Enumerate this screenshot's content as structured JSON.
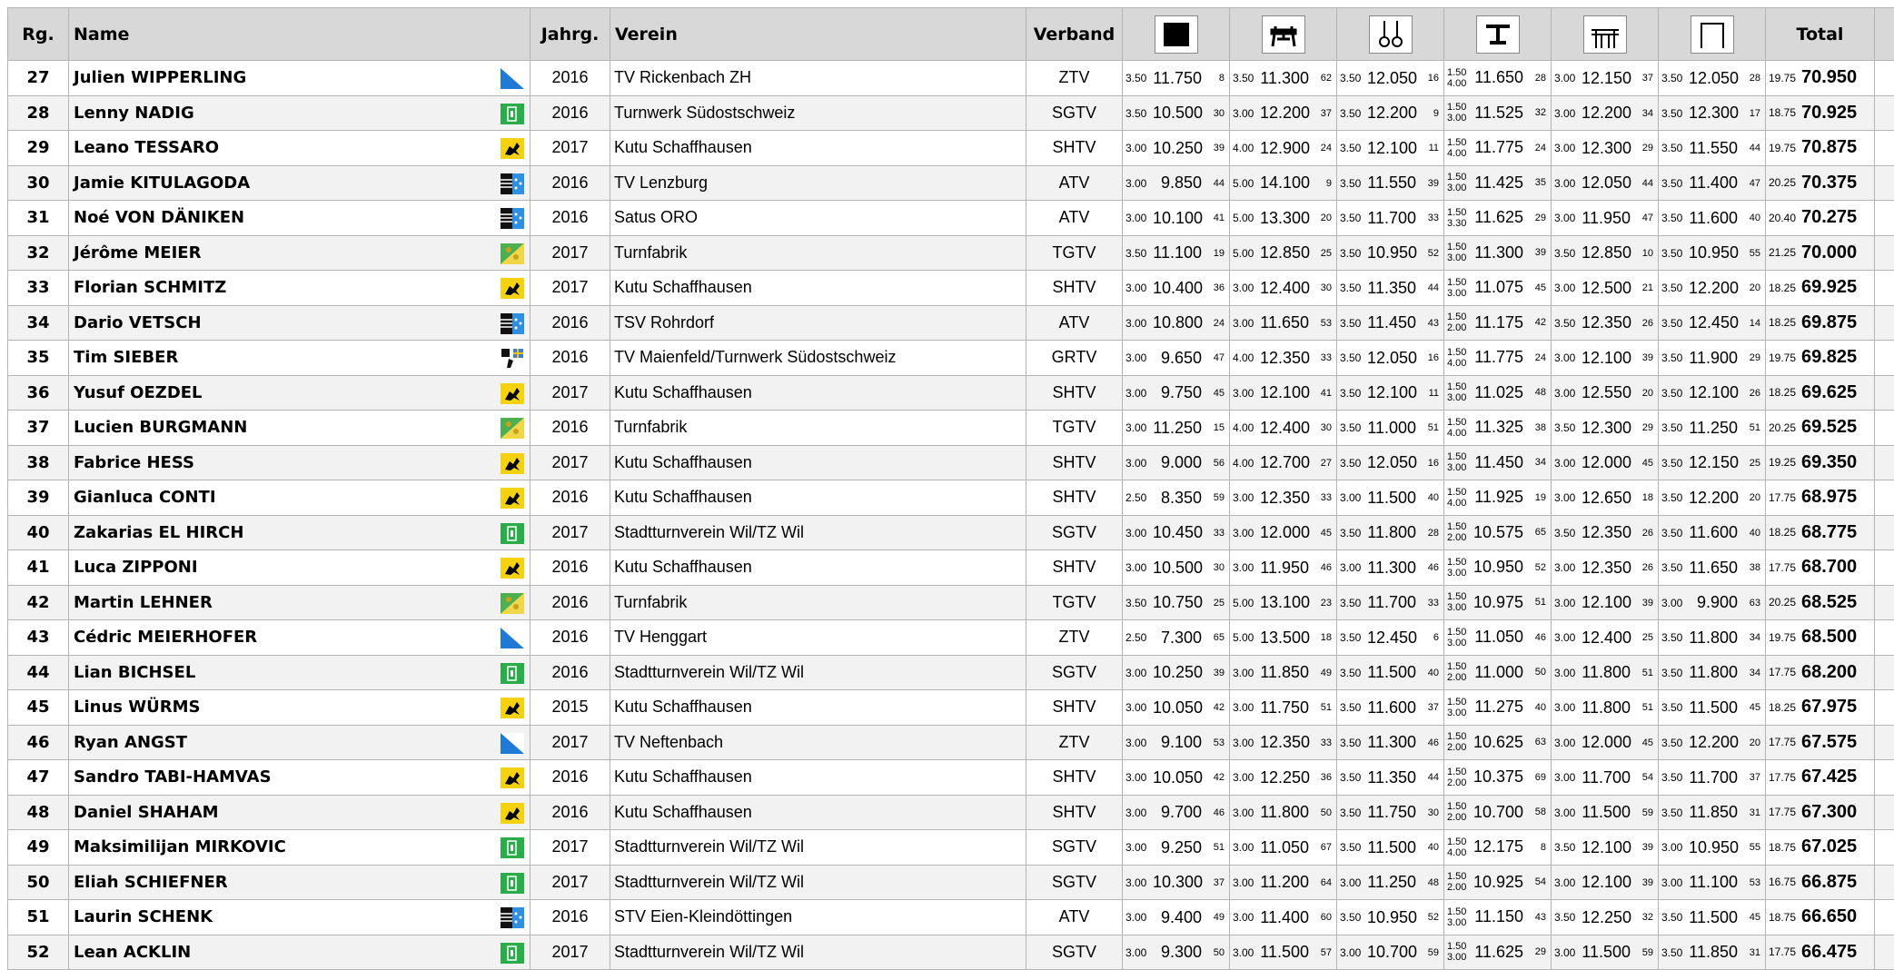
{
  "headers": {
    "rank": "Rg.",
    "name": "Name",
    "year": "Jahrg.",
    "club": "Verein",
    "federation": "Verband",
    "apparatus_icons": [
      "floor-icon",
      "pommel-horse-icon",
      "rings-icon",
      "vault-icon",
      "parallel-bars-icon",
      "high-bar-icon"
    ],
    "total": "Total"
  },
  "rows": [
    {
      "rank": "27",
      "name": "Julien WIPPERLING",
      "flag": "flag-zurich-icon",
      "year": "2016",
      "club": "TV Rickenbach ZH",
      "fed": "ZTV",
      "apps": [
        [
          "3.50",
          "11.750",
          "8"
        ],
        [
          "3.50",
          "11.300",
          "62"
        ],
        [
          "3.50",
          "12.050",
          "16"
        ],
        [
          "1.50",
          "4.00",
          "11.650",
          "28"
        ],
        [
          "3.00",
          "12.150",
          "37"
        ],
        [
          "3.50",
          "12.050",
          "28"
        ]
      ],
      "total_d": "19.75",
      "total": "70.950"
    },
    {
      "rank": "28",
      "name": "Lenny NADIG",
      "flag": "flag-stgallen-icon",
      "year": "2016",
      "club": "Turnwerk Südostschweiz",
      "fed": "SGTV",
      "apps": [
        [
          "3.50",
          "10.500",
          "30"
        ],
        [
          "3.00",
          "12.200",
          "37"
        ],
        [
          "3.50",
          "12.200",
          "9"
        ],
        [
          "1.50",
          "3.00",
          "11.525",
          "32"
        ],
        [
          "3.00",
          "12.200",
          "34"
        ],
        [
          "3.50",
          "12.300",
          "17"
        ]
      ],
      "total_d": "18.75",
      "total": "70.925"
    },
    {
      "rank": "29",
      "name": "Leano TESSARO",
      "flag": "flag-schaffhausen-icon",
      "year": "2017",
      "club": "Kutu Schaffhausen",
      "fed": "SHTV",
      "apps": [
        [
          "3.00",
          "10.250",
          "39"
        ],
        [
          "4.00",
          "12.900",
          "24"
        ],
        [
          "3.50",
          "12.100",
          "11"
        ],
        [
          "1.50",
          "4.00",
          "11.775",
          "24"
        ],
        [
          "3.00",
          "12.300",
          "29"
        ],
        [
          "3.50",
          "11.550",
          "44"
        ]
      ],
      "total_d": "19.75",
      "total": "70.875"
    },
    {
      "rank": "30",
      "name": "Jamie KITULAGODA",
      "flag": "flag-aargau-icon",
      "year": "2016",
      "club": "TV Lenzburg",
      "fed": "ATV",
      "apps": [
        [
          "3.00",
          "9.850",
          "44"
        ],
        [
          "5.00",
          "14.100",
          "9"
        ],
        [
          "3.50",
          "11.550",
          "39"
        ],
        [
          "1.50",
          "3.00",
          "11.425",
          "35"
        ],
        [
          "3.00",
          "12.050",
          "44"
        ],
        [
          "3.50",
          "11.400",
          "47"
        ]
      ],
      "total_d": "20.25",
      "total": "70.375"
    },
    {
      "rank": "31",
      "name": "Noé VON DÄNIKEN",
      "flag": "flag-aargau-icon",
      "year": "2016",
      "club": "Satus ORO",
      "fed": "ATV",
      "apps": [
        [
          "3.00",
          "10.100",
          "41"
        ],
        [
          "5.00",
          "13.300",
          "20"
        ],
        [
          "3.50",
          "11.700",
          "33"
        ],
        [
          "1.50",
          "3.30",
          "11.625",
          "29"
        ],
        [
          "3.00",
          "11.950",
          "47"
        ],
        [
          "3.50",
          "11.600",
          "40"
        ]
      ],
      "total_d": "20.40",
      "total": "70.275"
    },
    {
      "rank": "32",
      "name": "Jérôme MEIER",
      "flag": "flag-thurgau-icon",
      "year": "2017",
      "club": "Turnfabrik",
      "fed": "TGTV",
      "apps": [
        [
          "3.50",
          "11.100",
          "19"
        ],
        [
          "5.00",
          "12.850",
          "25"
        ],
        [
          "3.50",
          "10.950",
          "52"
        ],
        [
          "1.50",
          "3.00",
          "11.300",
          "39"
        ],
        [
          "3.50",
          "12.850",
          "10"
        ],
        [
          "3.50",
          "10.950",
          "55"
        ]
      ],
      "total_d": "21.25",
      "total": "70.000"
    },
    {
      "rank": "33",
      "name": "Florian SCHMITZ",
      "flag": "flag-schaffhausen-icon",
      "year": "2017",
      "club": "Kutu Schaffhausen",
      "fed": "SHTV",
      "apps": [
        [
          "3.00",
          "10.400",
          "36"
        ],
        [
          "3.00",
          "12.400",
          "30"
        ],
        [
          "3.50",
          "11.350",
          "44"
        ],
        [
          "1.50",
          "3.00",
          "11.075",
          "45"
        ],
        [
          "3.00",
          "12.500",
          "21"
        ],
        [
          "3.50",
          "12.200",
          "20"
        ]
      ],
      "total_d": "18.25",
      "total": "69.925"
    },
    {
      "rank": "34",
      "name": "Dario VETSCH",
      "flag": "flag-aargau-icon",
      "year": "2016",
      "club": "TSV Rohrdorf",
      "fed": "ATV",
      "apps": [
        [
          "3.00",
          "10.800",
          "24"
        ],
        [
          "3.00",
          "11.650",
          "53"
        ],
        [
          "3.50",
          "11.450",
          "43"
        ],
        [
          "1.50",
          "2.00",
          "11.175",
          "42"
        ],
        [
          "3.50",
          "12.350",
          "26"
        ],
        [
          "3.50",
          "12.450",
          "14"
        ]
      ],
      "total_d": "18.25",
      "total": "69.875"
    },
    {
      "rank": "35",
      "name": "Tim SIEBER",
      "flag": "flag-graubuenden-icon",
      "year": "2016",
      "club": "TV Maienfeld/Turnwerk Südostschweiz",
      "fed": "GRTV",
      "apps": [
        [
          "3.00",
          "9.650",
          "47"
        ],
        [
          "4.00",
          "12.350",
          "33"
        ],
        [
          "3.50",
          "12.050",
          "16"
        ],
        [
          "1.50",
          "4.00",
          "11.775",
          "24"
        ],
        [
          "3.00",
          "12.100",
          "39"
        ],
        [
          "3.50",
          "11.900",
          "29"
        ]
      ],
      "total_d": "19.75",
      "total": "69.825"
    },
    {
      "rank": "36",
      "name": "Yusuf OEZDEL",
      "flag": "flag-schaffhausen-icon",
      "year": "2017",
      "club": "Kutu Schaffhausen",
      "fed": "SHTV",
      "apps": [
        [
          "3.00",
          "9.750",
          "45"
        ],
        [
          "3.00",
          "12.100",
          "41"
        ],
        [
          "3.50",
          "12.100",
          "11"
        ],
        [
          "1.50",
          "3.00",
          "11.025",
          "48"
        ],
        [
          "3.00",
          "12.550",
          "20"
        ],
        [
          "3.50",
          "12.100",
          "26"
        ]
      ],
      "total_d": "18.25",
      "total": "69.625"
    },
    {
      "rank": "37",
      "name": "Lucien BURGMANN",
      "flag": "flag-thurgau-icon",
      "year": "2016",
      "club": "Turnfabrik",
      "fed": "TGTV",
      "apps": [
        [
          "3.00",
          "11.250",
          "15"
        ],
        [
          "4.00",
          "12.400",
          "30"
        ],
        [
          "3.50",
          "11.000",
          "51"
        ],
        [
          "1.50",
          "4.00",
          "11.325",
          "38"
        ],
        [
          "3.50",
          "12.300",
          "29"
        ],
        [
          "3.50",
          "11.250",
          "51"
        ]
      ],
      "total_d": "20.25",
      "total": "69.525"
    },
    {
      "rank": "38",
      "name": "Fabrice HESS",
      "flag": "flag-schaffhausen-icon",
      "year": "2017",
      "club": "Kutu Schaffhausen",
      "fed": "SHTV",
      "apps": [
        [
          "3.00",
          "9.000",
          "56"
        ],
        [
          "4.00",
          "12.700",
          "27"
        ],
        [
          "3.50",
          "12.050",
          "16"
        ],
        [
          "1.50",
          "3.00",
          "11.450",
          "34"
        ],
        [
          "3.00",
          "12.000",
          "45"
        ],
        [
          "3.50",
          "12.150",
          "25"
        ]
      ],
      "total_d": "19.25",
      "total": "69.350"
    },
    {
      "rank": "39",
      "name": "Gianluca CONTI",
      "flag": "flag-schaffhausen-icon",
      "year": "2016",
      "club": "Kutu Schaffhausen",
      "fed": "SHTV",
      "apps": [
        [
          "2.50",
          "8.350",
          "59"
        ],
        [
          "3.00",
          "12.350",
          "33"
        ],
        [
          "3.00",
          "11.500",
          "40"
        ],
        [
          "1.50",
          "4.00",
          "11.925",
          "19"
        ],
        [
          "3.00",
          "12.650",
          "18"
        ],
        [
          "3.50",
          "12.200",
          "20"
        ]
      ],
      "total_d": "17.75",
      "total": "68.975"
    },
    {
      "rank": "40",
      "name": "Zakarias EL HIRCH",
      "flag": "flag-stgallen-icon",
      "year": "2017",
      "club": "Stadtturnverein Wil/TZ Wil",
      "fed": "SGTV",
      "apps": [
        [
          "3.00",
          "10.450",
          "33"
        ],
        [
          "3.00",
          "12.000",
          "45"
        ],
        [
          "3.50",
          "11.800",
          "28"
        ],
        [
          "1.50",
          "2.00",
          "10.575",
          "65"
        ],
        [
          "3.50",
          "12.350",
          "26"
        ],
        [
          "3.50",
          "11.600",
          "40"
        ]
      ],
      "total_d": "18.25",
      "total": "68.775"
    },
    {
      "rank": "41",
      "name": "Luca ZIPPONI",
      "flag": "flag-schaffhausen-icon",
      "year": "2016",
      "club": "Kutu Schaffhausen",
      "fed": "SHTV",
      "apps": [
        [
          "3.00",
          "10.500",
          "30"
        ],
        [
          "3.00",
          "11.950",
          "46"
        ],
        [
          "3.00",
          "11.300",
          "46"
        ],
        [
          "1.50",
          "3.00",
          "10.950",
          "52"
        ],
        [
          "3.00",
          "12.350",
          "26"
        ],
        [
          "3.50",
          "11.650",
          "38"
        ]
      ],
      "total_d": "17.75",
      "total": "68.700"
    },
    {
      "rank": "42",
      "name": "Martin LEHNER",
      "flag": "flag-thurgau-icon",
      "year": "2016",
      "club": "Turnfabrik",
      "fed": "TGTV",
      "apps": [
        [
          "3.50",
          "10.750",
          "25"
        ],
        [
          "5.00",
          "13.100",
          "23"
        ],
        [
          "3.50",
          "11.700",
          "33"
        ],
        [
          "1.50",
          "3.00",
          "10.975",
          "51"
        ],
        [
          "3.00",
          "12.100",
          "39"
        ],
        [
          "3.00",
          "9.900",
          "63"
        ]
      ],
      "total_d": "20.25",
      "total": "68.525"
    },
    {
      "rank": "43",
      "name": "Cédric MEIERHOFER",
      "flag": "flag-zurich-icon",
      "year": "2016",
      "club": "TV Henggart",
      "fed": "ZTV",
      "apps": [
        [
          "2.50",
          "7.300",
          "65"
        ],
        [
          "5.00",
          "13.500",
          "18"
        ],
        [
          "3.50",
          "12.450",
          "6"
        ],
        [
          "1.50",
          "3.00",
          "11.050",
          "46"
        ],
        [
          "3.00",
          "12.400",
          "25"
        ],
        [
          "3.50",
          "11.800",
          "34"
        ]
      ],
      "total_d": "19.75",
      "total": "68.500"
    },
    {
      "rank": "44",
      "name": "Lian BICHSEL",
      "flag": "flag-stgallen-icon",
      "year": "2016",
      "club": "Stadtturnverein Wil/TZ Wil",
      "fed": "SGTV",
      "apps": [
        [
          "3.00",
          "10.250",
          "39"
        ],
        [
          "3.00",
          "11.850",
          "49"
        ],
        [
          "3.50",
          "11.500",
          "40"
        ],
        [
          "1.50",
          "2.00",
          "11.000",
          "50"
        ],
        [
          "3.00",
          "11.800",
          "51"
        ],
        [
          "3.50",
          "11.800",
          "34"
        ]
      ],
      "total_d": "17.75",
      "total": "68.200"
    },
    {
      "rank": "45",
      "name": "Linus WÜRMS",
      "flag": "flag-schaffhausen-icon",
      "year": "2015",
      "club": "Kutu Schaffhausen",
      "fed": "SHTV",
      "apps": [
        [
          "3.00",
          "10.050",
          "42"
        ],
        [
          "3.00",
          "11.750",
          "51"
        ],
        [
          "3.50",
          "11.600",
          "37"
        ],
        [
          "1.50",
          "3.00",
          "11.275",
          "40"
        ],
        [
          "3.00",
          "11.800",
          "51"
        ],
        [
          "3.50",
          "11.500",
          "45"
        ]
      ],
      "total_d": "18.25",
      "total": "67.975"
    },
    {
      "rank": "46",
      "name": "Ryan ANGST",
      "flag": "flag-zurich-icon",
      "year": "2017",
      "club": "TV Neftenbach",
      "fed": "ZTV",
      "apps": [
        [
          "3.00",
          "9.100",
          "53"
        ],
        [
          "3.00",
          "12.350",
          "33"
        ],
        [
          "3.50",
          "11.300",
          "46"
        ],
        [
          "1.50",
          "2.00",
          "10.625",
          "63"
        ],
        [
          "3.00",
          "12.000",
          "45"
        ],
        [
          "3.50",
          "12.200",
          "20"
        ]
      ],
      "total_d": "17.75",
      "total": "67.575"
    },
    {
      "rank": "47",
      "name": "Sandro TABI-HAMVAS",
      "flag": "flag-schaffhausen-icon",
      "year": "2016",
      "club": "Kutu Schaffhausen",
      "fed": "SHTV",
      "apps": [
        [
          "3.00",
          "10.050",
          "42"
        ],
        [
          "3.00",
          "12.250",
          "36"
        ],
        [
          "3.50",
          "11.350",
          "44"
        ],
        [
          "1.50",
          "2.00",
          "10.375",
          "69"
        ],
        [
          "3.00",
          "11.700",
          "54"
        ],
        [
          "3.50",
          "11.700",
          "37"
        ]
      ],
      "total_d": "17.75",
      "total": "67.425"
    },
    {
      "rank": "48",
      "name": "Daniel SHAHAM",
      "flag": "flag-schaffhausen-icon",
      "year": "2016",
      "club": "Kutu Schaffhausen",
      "fed": "SHTV",
      "apps": [
        [
          "3.00",
          "9.700",
          "46"
        ],
        [
          "3.00",
          "11.800",
          "50"
        ],
        [
          "3.50",
          "11.750",
          "30"
        ],
        [
          "1.50",
          "2.00",
          "10.700",
          "58"
        ],
        [
          "3.00",
          "11.500",
          "59"
        ],
        [
          "3.50",
          "11.850",
          "31"
        ]
      ],
      "total_d": "17.75",
      "total": "67.300"
    },
    {
      "rank": "49",
      "name": "Maksimilijan MIRKOVIC",
      "flag": "flag-stgallen-icon",
      "year": "2017",
      "club": "Stadtturnverein Wil/TZ Wil",
      "fed": "SGTV",
      "apps": [
        [
          "3.00",
          "9.250",
          "51"
        ],
        [
          "3.00",
          "11.050",
          "67"
        ],
        [
          "3.50",
          "11.500",
          "40"
        ],
        [
          "1.50",
          "4.00",
          "12.175",
          "8"
        ],
        [
          "3.50",
          "12.100",
          "39"
        ],
        [
          "3.00",
          "10.950",
          "55"
        ]
      ],
      "total_d": "18.75",
      "total": "67.025"
    },
    {
      "rank": "50",
      "name": "Eliah SCHIEFNER",
      "flag": "flag-stgallen-icon",
      "year": "2017",
      "club": "Stadtturnverein Wil/TZ Wil",
      "fed": "SGTV",
      "apps": [
        [
          "3.00",
          "10.300",
          "37"
        ],
        [
          "3.00",
          "11.200",
          "64"
        ],
        [
          "3.00",
          "11.250",
          "48"
        ],
        [
          "1.50",
          "2.00",
          "10.925",
          "54"
        ],
        [
          "3.00",
          "12.100",
          "39"
        ],
        [
          "3.00",
          "11.100",
          "53"
        ]
      ],
      "total_d": "16.75",
      "total": "66.875"
    },
    {
      "rank": "51",
      "name": "Laurin SCHENK",
      "flag": "flag-aargau-icon",
      "year": "2016",
      "club": "STV Eien-Kleindöttingen",
      "fed": "ATV",
      "apps": [
        [
          "3.00",
          "9.400",
          "49"
        ],
        [
          "3.00",
          "11.400",
          "60"
        ],
        [
          "3.50",
          "10.950",
          "52"
        ],
        [
          "1.50",
          "3.00",
          "11.150",
          "43"
        ],
        [
          "3.50",
          "12.250",
          "32"
        ],
        [
          "3.50",
          "11.500",
          "45"
        ]
      ],
      "total_d": "18.75",
      "total": "66.650"
    },
    {
      "rank": "52",
      "name": "Lean ACKLIN",
      "flag": "flag-stgallen-icon",
      "year": "2017",
      "club": "Stadtturnverein Wil/TZ Wil",
      "fed": "SGTV",
      "apps": [
        [
          "3.00",
          "9.300",
          "50"
        ],
        [
          "3.00",
          "11.500",
          "57"
        ],
        [
          "3.00",
          "10.700",
          "59"
        ],
        [
          "1.50",
          "3.00",
          "11.625",
          "29"
        ],
        [
          "3.00",
          "11.500",
          "59"
        ],
        [
          "3.50",
          "11.850",
          "31"
        ]
      ],
      "total_d": "17.75",
      "total": "66.475"
    }
  ]
}
